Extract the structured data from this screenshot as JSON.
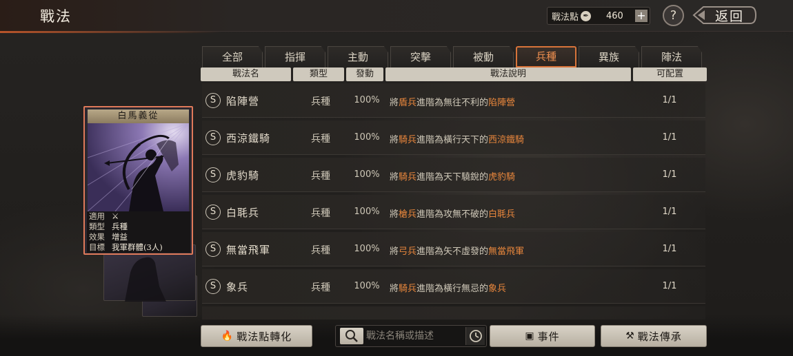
{
  "header": {
    "title": "戰法",
    "points_label": "戰法點",
    "points_value": "460",
    "plus": "+",
    "help": "?",
    "back_label": "返回"
  },
  "tabs": [
    {
      "label": "全部"
    },
    {
      "label": "指揮"
    },
    {
      "label": "主動"
    },
    {
      "label": "突擊"
    },
    {
      "label": "被動"
    },
    {
      "label": "兵種",
      "active": true
    },
    {
      "label": "異族"
    },
    {
      "label": "陣法"
    }
  ],
  "columns": {
    "name": "戰法名",
    "type": "類型",
    "rate": "發動",
    "desc": "戰法說明",
    "cap": "可配置"
  },
  "rows": [
    {
      "grade": "S",
      "name": "陷陣營",
      "type": "兵種",
      "rate": "100%",
      "desc_pre": "將",
      "desc_unit": "盾兵",
      "desc_mid": "進階為無往不利的",
      "desc_target": "陷陣營",
      "cap": "1/1"
    },
    {
      "grade": "S",
      "name": "西涼鐵騎",
      "type": "兵種",
      "rate": "100%",
      "desc_pre": "將",
      "desc_unit": "騎兵",
      "desc_mid": "進階為橫行天下的",
      "desc_target": "西涼鐵騎",
      "cap": "1/1"
    },
    {
      "grade": "S",
      "name": "虎豹騎",
      "type": "兵種",
      "rate": "100%",
      "desc_pre": "將",
      "desc_unit": "騎兵",
      "desc_mid": "進階為天下驍銳的",
      "desc_target": "虎豹騎",
      "cap": "1/1"
    },
    {
      "grade": "S",
      "name": "白毦兵",
      "type": "兵種",
      "rate": "100%",
      "desc_pre": "將",
      "desc_unit": "槍兵",
      "desc_mid": "進階為攻無不破的",
      "desc_target": "白毦兵",
      "cap": "1/1"
    },
    {
      "grade": "S",
      "name": "無當飛軍",
      "type": "兵種",
      "rate": "100%",
      "desc_pre": "將",
      "desc_unit": "弓兵",
      "desc_mid": "進階為矢不虛發的",
      "desc_target": "無當飛軍",
      "cap": "1/1"
    },
    {
      "grade": "S",
      "name": "象兵",
      "type": "兵種",
      "rate": "100%",
      "desc_pre": "將",
      "desc_unit": "騎兵",
      "desc_mid": "進階為橫行無忌的",
      "desc_target": "象兵",
      "cap": "1/1"
    }
  ],
  "card": {
    "title": "白馬義從",
    "info": [
      {
        "k": "適用",
        "v": ""
      },
      {
        "k": "類型",
        "v": "兵種"
      },
      {
        "k": "效果",
        "v": "增益"
      },
      {
        "k": "目標",
        "v": "我軍群體(3人)"
      }
    ]
  },
  "bottom": {
    "convert_label": "戰法點轉化",
    "search_placeholder": "戰法名稱或描述",
    "event_label": "事件",
    "inherit_label": "戰法傳承"
  },
  "colors": {
    "accent": "#d9743a",
    "highlight": "#e8863c"
  }
}
